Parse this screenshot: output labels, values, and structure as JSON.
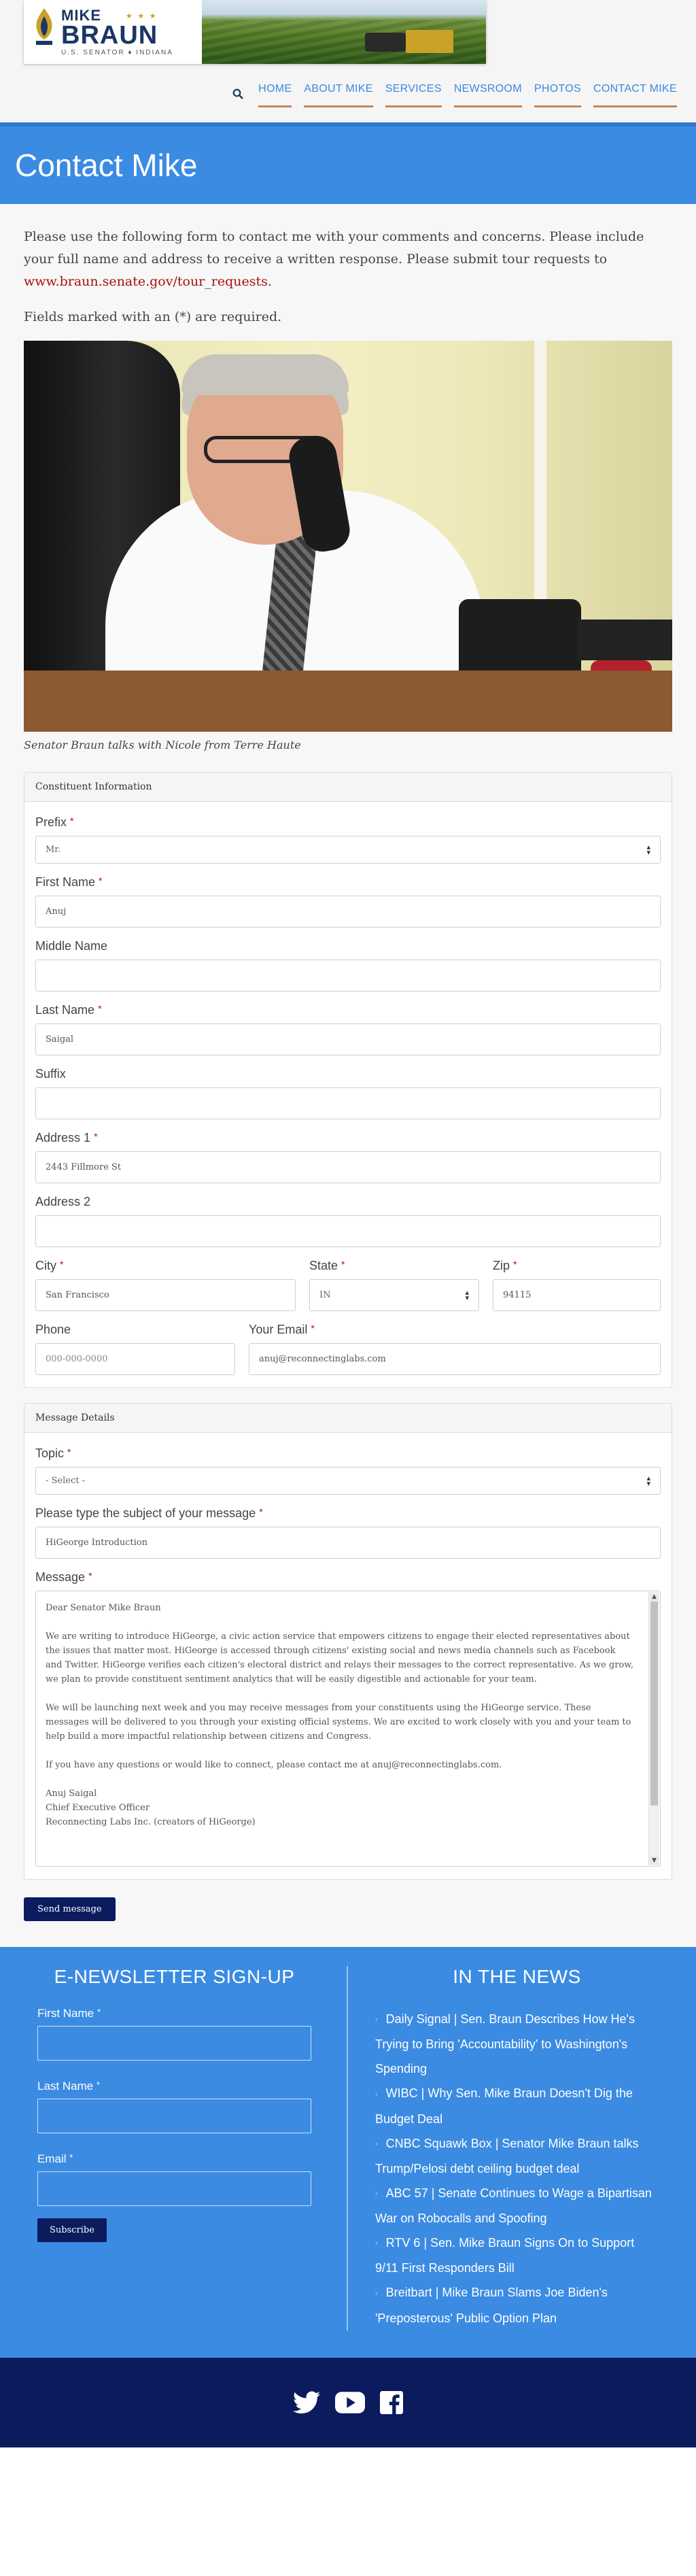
{
  "header": {
    "logo": {
      "line1": "MIKE",
      "line2": "BRAUN",
      "line3": "U.S. SENATOR ♦ INDIANA",
      "stars": "★ ★ ★"
    },
    "nav": {
      "search_icon": "search-icon",
      "items": [
        {
          "label": "HOME"
        },
        {
          "label": "ABOUT MIKE"
        },
        {
          "label": "SERVICES"
        },
        {
          "label": "NEWSROOM"
        },
        {
          "label": "PHOTOS"
        },
        {
          "label": "CONTACT MIKE"
        }
      ]
    }
  },
  "hero": {
    "title": "Contact Mike"
  },
  "intro": {
    "text": "Please use the following form to contact me with your comments and concerns. Please include your full name and address to receive a written response. Please submit tour requests to ",
    "link": "www.braun.senate.gov/tour_requests",
    "text_end": ".",
    "required_note": "Fields marked with an (*) are required."
  },
  "photo": {
    "caption": "Senator Braun talks with Nicole from Terre Haute"
  },
  "constituent": {
    "title": "Constituent Information",
    "prefix": {
      "label": "Prefix",
      "value": "Mr."
    },
    "first_name": {
      "label": "First Name",
      "value": "Anuj"
    },
    "middle_name": {
      "label": "Middle Name",
      "value": ""
    },
    "last_name": {
      "label": "Last Name",
      "value": "Saigal"
    },
    "suffix": {
      "label": "Suffix",
      "value": ""
    },
    "address1": {
      "label": "Address 1",
      "value": "2443 Fillmore St"
    },
    "address2": {
      "label": "Address 2",
      "value": ""
    },
    "city": {
      "label": "City",
      "value": "San Francisco"
    },
    "state": {
      "label": "State",
      "value": "IN"
    },
    "zip": {
      "label": "Zip",
      "value": "94115"
    },
    "phone": {
      "label": "Phone",
      "placeholder": "000-000-0000"
    },
    "email": {
      "label": "Your Email",
      "value": "anuj@reconnectinglabs.com"
    }
  },
  "message": {
    "title": "Message Details",
    "topic": {
      "label": "Topic",
      "value": "- Select -"
    },
    "subject": {
      "label": "Please type the subject of your message",
      "value": "HiGeorge Introduction"
    },
    "body_label": "Message",
    "body": {
      "p1": "Dear Senator Mike Braun",
      "p2": "We are writing to introduce HiGeorge, a civic action service that empowers citizens to engage their elected representatives about the issues that matter most. HiGeorge is accessed through citizens' existing social and news media channels such as Facebook and Twitter. HiGeorge verifies each citizen's electoral district and relays their messages to the correct representative.  As we grow, we plan to provide constituent sentiment analytics that will be easily digestible and actionable for your team.",
      "p3": "We will be launching next week and you may receive messages from your constituents using the HiGeorge service. These messages will be delivered to you through your existing official systems. We are excited to work closely with you and your team to help build a more impactful relationship between citizens and Congress.",
      "p4": "If you have any questions or would like to connect, please contact me at anuj@reconnectinglabs.com.",
      "sig1": "Anuj Saigal",
      "sig2": "Chief Executive Officer",
      "sig3": "Reconnecting Labs Inc. (creators of HiGeorge)"
    },
    "send_label": "Send message"
  },
  "newsletter": {
    "title": "E-NEWSLETTER SIGN-UP",
    "first_name_label": "First Name",
    "last_name_label": "Last Name",
    "email_label": "Email",
    "subscribe_label": "Subscribe"
  },
  "news": {
    "title": "IN THE NEWS",
    "items": [
      {
        "text": "Daily Signal | Sen. Braun Describes How He's Trying to Bring 'Accountability' to Washington's Spending"
      },
      {
        "text": "WIBC | Why Sen. Mike Braun Doesn't Dig the Budget Deal"
      },
      {
        "text": "CNBC Squawk Box | Senator Mike Braun talks Trump/Pelosi debt ceiling budget deal"
      },
      {
        "text": "ABC 57 | Senate Continues to Wage a Bipartisan War on Robocalls and Spoofing"
      },
      {
        "text": "RTV 6 | Sen. Mike Braun Signs On to Support 9/11 First Responders Bill"
      },
      {
        "text": "Breitbart | Mike Braun Slams Joe Biden's 'Preposterous' Public Option Plan"
      }
    ]
  },
  "social": {
    "icons": [
      "twitter-icon",
      "youtube-icon",
      "facebook-icon"
    ]
  },
  "colors": {
    "brand_blue": "#3b8be2",
    "navy": "#0b1b5e",
    "link_red": "#a81010",
    "nav_underline": "#c7845a"
  }
}
